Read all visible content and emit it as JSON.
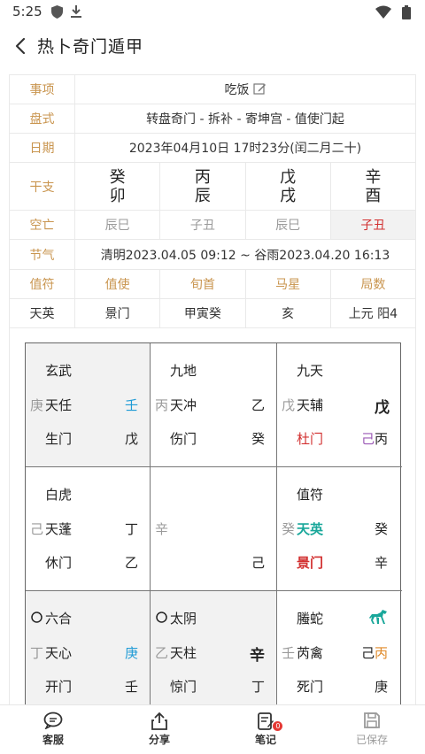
{
  "status_bar": {
    "time": "5:25"
  },
  "header": {
    "title": "热卜奇门遁甲"
  },
  "info": {
    "matter": {
      "label": "事项",
      "value": "吃饭"
    },
    "pan_style": {
      "label": "盘式",
      "value": "转盘奇门 - 拆补 - 寄坤宫 - 值使门起"
    },
    "date": {
      "label": "日期",
      "value": "2023年04月10日 17时23分(闰二月二十)"
    },
    "ganzhi": {
      "label": "干支",
      "pillars": [
        {
          "top": "癸",
          "bottom": "卯"
        },
        {
          "top": "丙",
          "bottom": "辰"
        },
        {
          "top": "戊",
          "bottom": "戌"
        },
        {
          "top": "辛",
          "bottom": "酉"
        }
      ]
    },
    "kongwang": {
      "label": "空亡",
      "values": [
        "辰巳",
        "子丑",
        "辰巳",
        "子丑"
      ]
    },
    "jieqi": {
      "label": "节气",
      "value": "清明2023.04.05 09:12 ~ 谷雨2023.04.20 16:13"
    },
    "headers": [
      "值符",
      "值使",
      "旬首",
      "马星",
      "局数"
    ],
    "values": [
      "天英",
      "景门",
      "甲寅癸",
      "亥",
      "上元 阳4"
    ]
  },
  "palaces": {
    "xuanwu": {
      "god": "玄武",
      "hidden": "庚",
      "star": "天任",
      "heaven_stem": "壬",
      "door": "生门",
      "earth_stem": "戊"
    },
    "jiudi": {
      "god": "九地",
      "hidden": "丙",
      "star": "天冲",
      "heaven_stem": "乙",
      "door": "伤门",
      "earth_stem": "癸"
    },
    "jiutian": {
      "god": "九天",
      "hidden": "戊",
      "star": "天辅",
      "heaven_stem": "戊",
      "door": "杜门",
      "earth_stem_1": "己",
      "earth_stem_2": "丙"
    },
    "baihu": {
      "god": "白虎",
      "hidden": "己",
      "star": "天蓬",
      "heaven_stem": "丁",
      "door": "休门",
      "earth_stem": "乙"
    },
    "center": {
      "hidden": "辛",
      "earth_stem": "己"
    },
    "zhifu": {
      "god": "值符",
      "hidden": "癸",
      "star": "天英",
      "heaven_stem": "癸",
      "door": "景门",
      "earth_stem": "辛"
    },
    "liuhe": {
      "god": "六合",
      "hidden": "丁",
      "star": "天心",
      "heaven_stem": "庚",
      "door": "开门",
      "earth_stem": "壬"
    },
    "taiyin": {
      "god": "太阴",
      "hidden": "乙",
      "star": "天柱",
      "heaven_stem": "辛",
      "door": "惊门",
      "earth_stem": "丁"
    },
    "tengshe": {
      "god": "螣蛇",
      "hidden": "壬",
      "star": "芮禽",
      "heaven_stem_1": "己",
      "heaven_stem_2": "丙",
      "door": "死门",
      "earth_stem": "庚"
    }
  },
  "bottom_nav": [
    {
      "label": "客服",
      "icon": "chat-icon"
    },
    {
      "label": "分享",
      "icon": "share-icon"
    },
    {
      "label": "笔记",
      "icon": "note-icon",
      "badge": "0"
    },
    {
      "label": "已保存",
      "icon": "save-icon"
    }
  ]
}
